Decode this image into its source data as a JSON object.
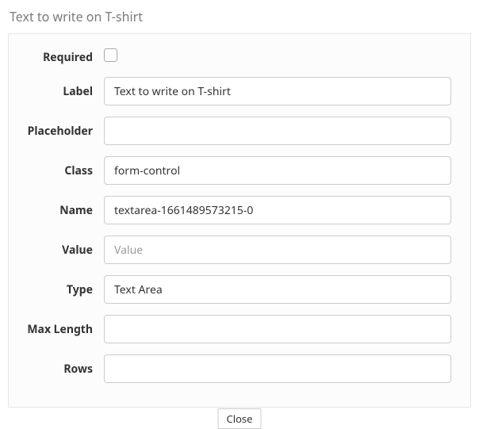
{
  "title": "Text to write on T-shirt",
  "labels": {
    "required": "Required",
    "label": "Label",
    "placeholder": "Placeholder",
    "class": "Class",
    "name": "Name",
    "value": "Value",
    "type": "Type",
    "maxlength": "Max Length",
    "rows": "Rows"
  },
  "values": {
    "required": false,
    "label": "Text to write on T-shirt",
    "placeholder": "",
    "class": "form-control",
    "name": "textarea-1661489573215-0",
    "value": "",
    "value_placeholder": "Value",
    "type": "Text Area",
    "maxlength": "",
    "rows": ""
  },
  "buttons": {
    "close": "Close"
  }
}
